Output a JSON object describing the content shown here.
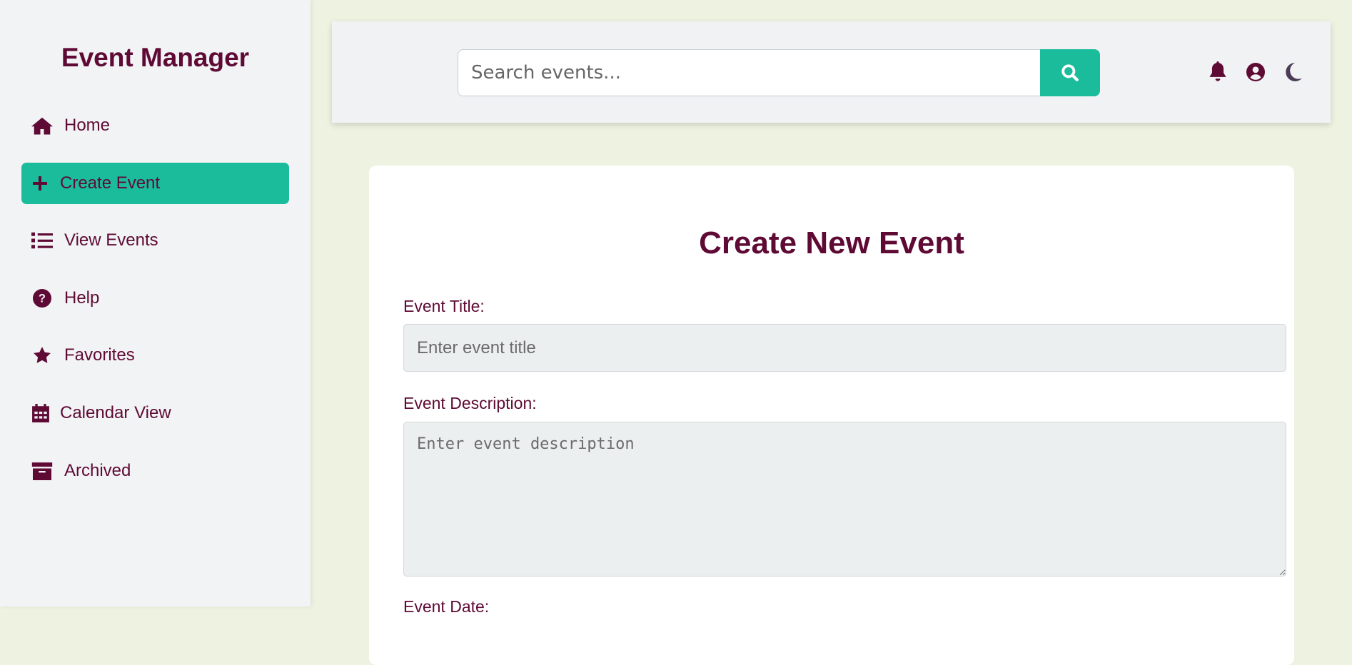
{
  "sidebar": {
    "brand": "Event Manager",
    "items": [
      {
        "label": "Home",
        "icon": "home-icon"
      },
      {
        "label": "Create Event",
        "icon": "plus-icon",
        "active": true
      },
      {
        "label": "View Events",
        "icon": "list-icon"
      },
      {
        "label": "Help",
        "icon": "question-circle-icon"
      },
      {
        "label": "Favorites",
        "icon": "star-icon"
      },
      {
        "label": "Calendar View",
        "icon": "calendar-icon"
      },
      {
        "label": "Archived",
        "icon": "archive-icon"
      }
    ]
  },
  "header": {
    "search_placeholder": "Search events...",
    "search_icon": "search-icon",
    "icons": [
      "bell-icon",
      "user-circle-icon",
      "moon-icon"
    ]
  },
  "form": {
    "title": "Create New Event",
    "title_label": "Event Title:",
    "title_placeholder": "Enter event title",
    "description_label": "Event Description:",
    "description_placeholder": "Enter event description",
    "date_label": "Event Date:"
  },
  "colors": {
    "primary": "#5e0a35",
    "accent": "#1abc9c",
    "background": "#eef2e1"
  }
}
